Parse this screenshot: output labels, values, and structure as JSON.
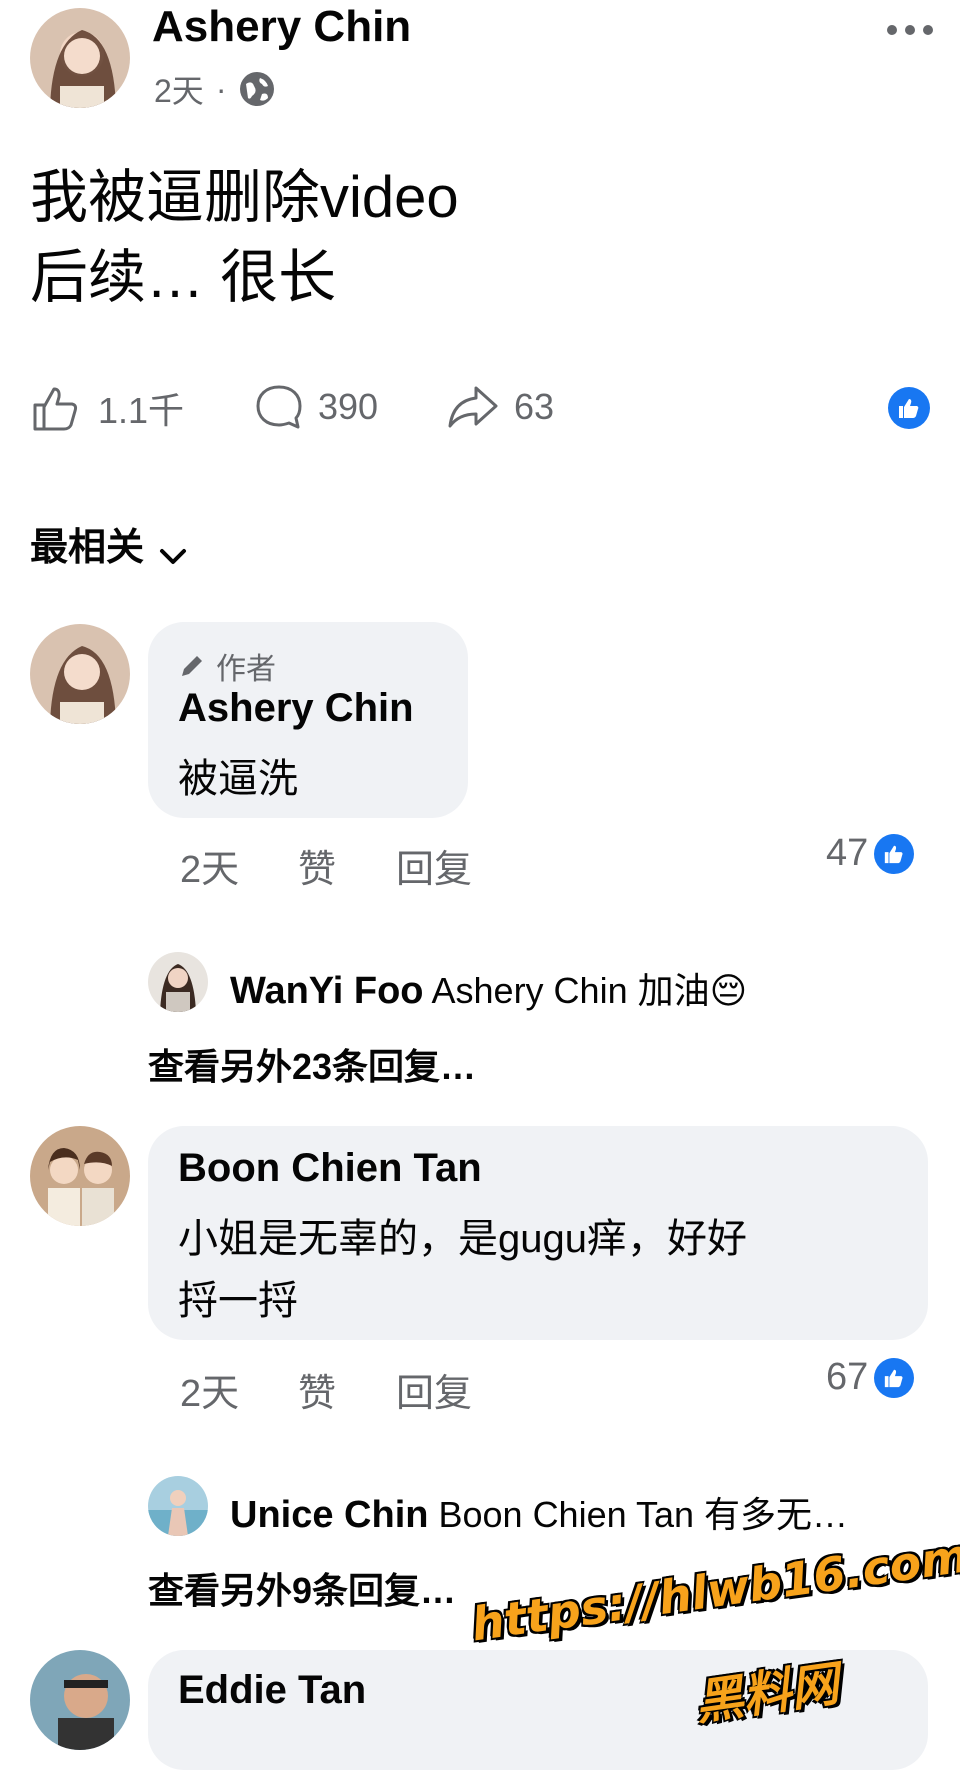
{
  "post": {
    "author": "Ashery Chin",
    "time": "2天",
    "dot": "·",
    "text_line1": "我被逼删除video",
    "text_line2": "后续… 很长",
    "likes": "1.1千",
    "comments": "390",
    "shares": "63"
  },
  "sort": {
    "label": "最相关"
  },
  "comments": [
    {
      "badge": "作者",
      "author": "Ashery Chin",
      "text": "被逼洗",
      "time": "2天",
      "like": "赞",
      "reply": "回复",
      "reactions": "47",
      "reply_preview": {
        "author": "WanYi Foo",
        "text": "Ashery Chin 加油😔"
      },
      "more_replies": "查看另外23条回复…"
    },
    {
      "author": "Boon Chien Tan",
      "text_line1": "小姐是无辜的，是gugu痒，好好",
      "text_line2": "捋一捋",
      "time": "2天",
      "like": "赞",
      "reply": "回复",
      "reactions": "67",
      "reply_preview": {
        "author": "Unice Chin",
        "text": "Boon Chien Tan 有多无…"
      },
      "more_replies": "查看另外9条回复…"
    },
    {
      "author": "Eddie Tan"
    }
  ],
  "watermark": {
    "line1": "https://hlwb16.com",
    "line2": "黑料网"
  },
  "colors": {
    "accent": "#1877f2",
    "bubble": "#f0f2f5",
    "meta": "#65676b",
    "watermark": "#f7a21b"
  }
}
